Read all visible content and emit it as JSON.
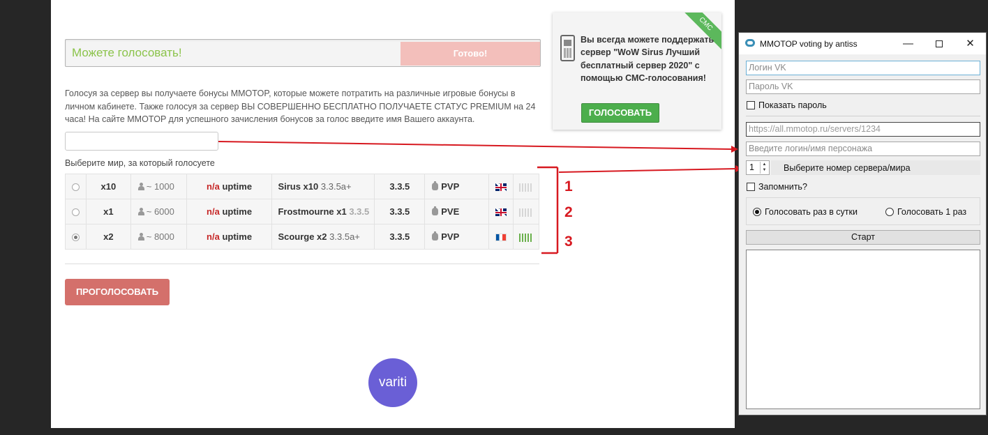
{
  "page": {
    "status_text": "Можете голосовать!",
    "done_label": "Готово!",
    "description": "Голосуя за сервер вы получаете бонусы MMOTOP, которые можете потратить на различные игровые бонусы в личном кабинете. Также голосуя за сервер ВЫ СОВЕРШЕННО БЕСПЛАТНО ПОЛУЧАЕТЕ СТАТУС PREMIUM на 24 часа! На сайте MMOTOP для успешного зачисления бонусов за голос введите имя Вашего аккаунта.",
    "world_label": "Выберите мир, за который голосуете",
    "servers": [
      {
        "rate": "x10",
        "online": "~ 1000",
        "na": "n/a",
        "uptime": "uptime",
        "name": "Sirus x10",
        "name_ver": "3.3.5a+",
        "version": "3.3.5",
        "type": "PVP",
        "flag": "uk",
        "bars": "grey",
        "selected": false
      },
      {
        "rate": "x1",
        "online": "~ 6000",
        "na": "n/a",
        "uptime": "uptime",
        "name": "Frostmourne x1",
        "name_ver": "3.3.5",
        "version": "3.3.5",
        "type": "PVE",
        "flag": "uk",
        "bars": "grey",
        "selected": false
      },
      {
        "rate": "x2",
        "online": "~ 8000",
        "na": "n/a",
        "uptime": "uptime",
        "name": "Scourge x2",
        "name_ver": "3.3.5a+",
        "version": "3.3.5",
        "type": "PVP",
        "flag": "fr",
        "bars": "green",
        "selected": true
      }
    ],
    "vote_label": "ПРОГОЛОСОВАТЬ",
    "logo_text": "variti"
  },
  "sms": {
    "ribbon": "СМС",
    "text": "Вы всегда можете поддержать сервер \"WoW Sirus Лучший бесплатный сервер 2020\" с помощью СМС-голосования!",
    "button": "ГОЛОСОВАТЬ"
  },
  "annotations": {
    "numbers": [
      "1",
      "2",
      "3"
    ],
    "color": "#d71920"
  },
  "app": {
    "title": "MMOTOP voting by antiss",
    "login_placeholder": "Логин VK",
    "password_placeholder": "Пароль VK",
    "show_password": "Показать пароль",
    "server_url_placeholder": "https://all.mmotop.ru/servers/1234",
    "character_placeholder": "Введите логин/имя персонажа",
    "server_number": "1",
    "server_label": "Выберите номер сервера/мира",
    "remember": "Запомнить?",
    "mode_daily": "Голосовать раз в сутки",
    "mode_once": "Голосовать 1 раз",
    "start": "Старт"
  },
  "colors": {
    "accent_green": "#8bc34a",
    "vote_red": "#d4706b",
    "sms_green": "#4cae4c",
    "variti": "#6a5fd6"
  }
}
